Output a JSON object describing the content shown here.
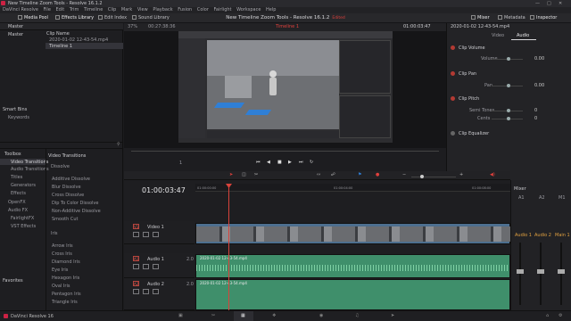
{
  "window": {
    "title": "New Timeline Zoom Tools - Resolve 16.1.2"
  },
  "menu": [
    "DaVinci Resolve",
    "File",
    "Edit",
    "Trim",
    "Timeline",
    "Clip",
    "Mark",
    "View",
    "Playback",
    "Fusion",
    "Color",
    "Fairlight",
    "Workspace",
    "Help"
  ],
  "toolbar": {
    "media_pool": "Media Pool",
    "effects_library": "Effects Library",
    "edit_index": "Edit Index",
    "sound_library": "Sound Library",
    "project_title": "New Timeline Zoom Tools",
    "edited": "Edited",
    "mixer": "Mixer",
    "metadata": "Metadata",
    "inspector": "Inspector"
  },
  "media_pool": {
    "master_header": "Master",
    "clip_name_header": "Clip Name",
    "tree_master": "Master",
    "clips": [
      "2020-01-02 12-43-54.mp4",
      "Timeline 1"
    ],
    "smart_bins": "Smart Bins",
    "keywords": "Keywords"
  },
  "viewer": {
    "zoom": "37%",
    "timecode": "00:27:38:36",
    "timeline_name": "Timeline 1",
    "current_tc": "01:00:03:47",
    "clip_title": "2020-01-02 12-43-54.mp4"
  },
  "inspector": {
    "tab_video": "Video",
    "tab_audio": "Audio",
    "sections": {
      "clip_volume": "Clip Volume",
      "volume_label": "Volume",
      "volume_value": "0.00",
      "clip_pan": "Clip Pan",
      "pan_label": "Pan",
      "pan_value": "0.00",
      "clip_pitch": "Clip Pitch",
      "semitones_label": "Semi Tones",
      "semitones_value": "0",
      "cents_label": "Cents",
      "cents_value": "0",
      "clip_equalizer": "Clip Equalizer"
    }
  },
  "effects": {
    "toolbox": "Toolbox",
    "tree": [
      "Video Transitions",
      "Audio Transitions",
      "Titles",
      "Generators",
      "Effects",
      "OpenFX",
      "Audio FX",
      "FairlightFX",
      "VST Effects"
    ],
    "favorites": "Favorites",
    "header": "Video Transitions",
    "dissolve_header": "Dissolve",
    "dissolve_items": [
      "Additive Dissolve",
      "Blur Dissolve",
      "Cross Dissolve",
      "Dip To Color Dissolve",
      "Non-Additive Dissolve",
      "Smooth Cut"
    ],
    "iris_header": "Iris",
    "iris_items": [
      "Arrow Iris",
      "Cross Iris",
      "Diamond Iris",
      "Eye Iris",
      "Hexagon Iris",
      "Oval Iris",
      "Pentagon Iris",
      "Triangle Iris"
    ]
  },
  "transport": {
    "frame_display": "1"
  },
  "timeline": {
    "timecode": "01:00:03:47",
    "ruler": [
      "01:00:00:00",
      "01:00:04:00",
      "01:00:08:00"
    ],
    "tracks": [
      {
        "id": "V1",
        "name": "Video 1"
      },
      {
        "id": "A1",
        "name": "Audio 1",
        "level": "2.0"
      },
      {
        "id": "A2",
        "name": "Audio 2",
        "level": "2.0"
      }
    ],
    "clip_label": "2020-01-02 12-43-54.mp4"
  },
  "mixer": {
    "title": "Mixer",
    "channels": [
      "A1",
      "A2",
      "M1"
    ],
    "channel_labels": [
      "Audio 1",
      "Audio 2",
      "Main 1"
    ]
  },
  "app_name": "DaVinci Resolve 16",
  "colors": {
    "accent": "#e0403c",
    "clip_video": "#4d6f8f",
    "clip_audio": "#3f8f6b",
    "playhead": "#d9433b"
  }
}
